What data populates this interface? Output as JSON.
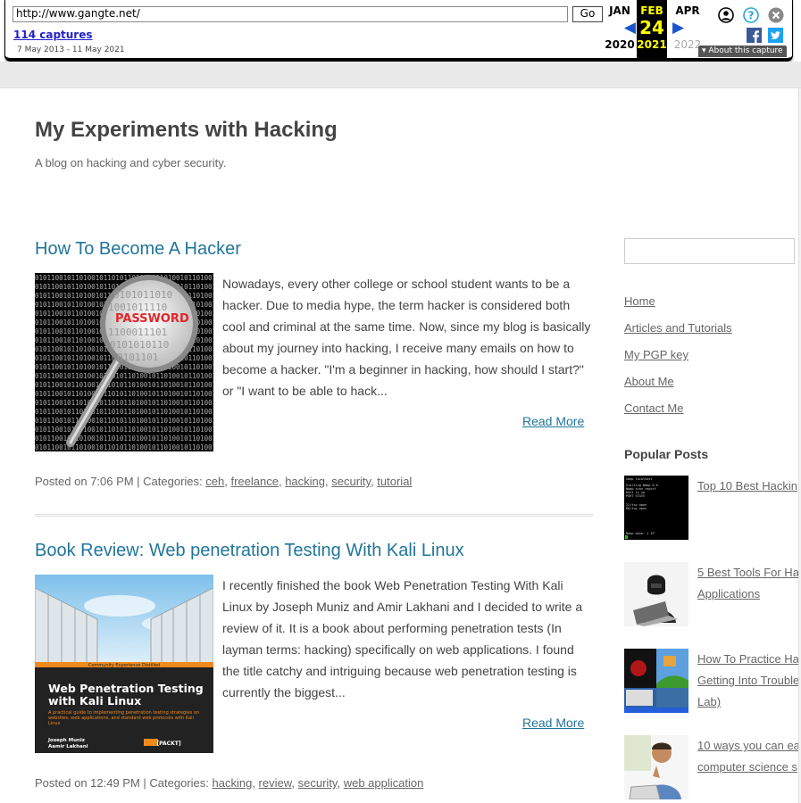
{
  "wayback": {
    "url": "http://www.gangte.net/",
    "go_label": "Go",
    "captures": "114 captures",
    "date_range": "7 May 2013 - 11 May 2021",
    "prev_month": "JAN",
    "cur_month": "FEB",
    "next_month": "APR",
    "cur_day": "24",
    "prev_year": "2020",
    "cur_year": "2021",
    "next_year": "2022",
    "about_label": "About this capture"
  },
  "site": {
    "title": "My Experiments with Hacking",
    "description": "A blog on hacking and cyber security."
  },
  "posts": [
    {
      "title": "How To Become A Hacker",
      "excerpt_lines": [
        "Nowadays, every other college or school student wants to be a",
        "hacker. Due to media hype, the term hacker is considered both",
        "cool and criminal at the same time. Now, since my blog is basically",
        "about my journey into hacking, I receive many emails on how to",
        "become a hacker. \"I'm a beginner in hacking, how should I start?\"",
        "or \"I want to be able to hack..."
      ],
      "read_more": "Read More",
      "meta_prefix": "Posted on 7:06 PM | Categories: ",
      "categories": [
        "ceh",
        "freelance",
        "hacking",
        "security",
        "tutorial"
      ],
      "thumb_text": "PASSWORD"
    },
    {
      "title": "Book Review: Web penetration Testing With Kali Linux",
      "excerpt_lines": [
        "I recently finished the book Web Penetration Testing With Kali",
        "Linux by Joseph Muniz and Amir Lakhani and I decided to write a",
        "review of it. It is a book about performing penetration tests (In",
        "layman terms: hacking) specifically on web applications. I found",
        "the title catchy and intriguing because web penetration testing is",
        "currently  the biggest..."
      ],
      "read_more": "Read More",
      "meta_prefix": "Posted on 12:49 PM | Categories: ",
      "categories": [
        "hacking",
        "review",
        "security",
        "web application"
      ],
      "book": {
        "series": "Community Experience Distilled",
        "title_line1": "Web Penetration Testing",
        "title_line2": "with Kali Linux",
        "subtitle": "A practical guide to implementing penetration testing strategies on websites, web applications, and standard web protocols with Kali Linux",
        "author1": "Joseph Muniz",
        "author2": "Aamir Lakhani",
        "publisher": "[PACKT]"
      }
    }
  ],
  "sidebar": {
    "nav": [
      "Home",
      "Articles and Tutorials",
      "My PGP key",
      "About Me",
      "Contact Me"
    ],
    "popular_heading": "Popular Posts",
    "popular": [
      {
        "lines": [
          "Top 10 Best Hackin"
        ]
      },
      {
        "lines": [
          "5 Best Tools For Ha",
          "Applications"
        ]
      },
      {
        "lines": [
          "How To Practice Ha",
          "Getting Into Trouble",
          "Lab)"
        ]
      },
      {
        "lines": [
          "10 ways you can ea",
          "computer science s"
        ]
      }
    ]
  },
  "icons": {
    "prev_arrow": "left-triangle",
    "next_arrow": "right-triangle",
    "user": "user-circle-icon",
    "help": "question-circle-icon",
    "close": "close-circle-icon",
    "facebook": "facebook-icon",
    "twitter": "twitter-icon"
  },
  "colors": {
    "link": "#21759b",
    "wayback_accent": "#ffff00",
    "wayback_link": "#2222cc"
  }
}
